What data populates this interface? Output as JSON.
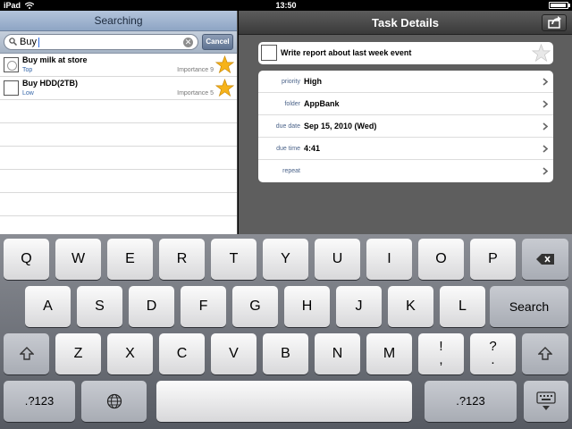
{
  "status_bar": {
    "carrier": "iPad",
    "time": "13:50"
  },
  "search_pane": {
    "title": "Searching",
    "query": "Buy",
    "cancel_label": "Cancel",
    "results": [
      {
        "title": "Buy milk at store",
        "category": "Top",
        "importance": "Importance 9"
      },
      {
        "title": "Buy HDD(2TB)",
        "category": "Low",
        "importance": "Importance 5"
      }
    ]
  },
  "detail_pane": {
    "title": "Task Details",
    "task_name": "Write report about last week event",
    "properties": [
      {
        "label": "priority",
        "value": "High"
      },
      {
        "label": "folder",
        "value": "AppBank"
      },
      {
        "label": "due date",
        "value": "Sep 15, 2010 (Wed)"
      },
      {
        "label": "due time",
        "value": "4:41"
      },
      {
        "label": "repeat",
        "value": ""
      }
    ]
  },
  "keyboard": {
    "row1": [
      "Q",
      "W",
      "E",
      "R",
      "T",
      "Y",
      "U",
      "I",
      "O",
      "P"
    ],
    "row2": [
      "A",
      "S",
      "D",
      "F",
      "G",
      "H",
      "J",
      "K",
      "L"
    ],
    "row3": [
      "Z",
      "X",
      "C",
      "V",
      "B",
      "N",
      "M"
    ],
    "search_label": "Search",
    "exclaim_top": "!",
    "exclaim_bottom": ",",
    "question_top": "?",
    "question_bottom": ".",
    "numbers_label": ".?123"
  },
  "colors": {
    "star": "#f6b31a",
    "nav_blue": "#8ea5c4",
    "label_blue": "#4b6389"
  }
}
